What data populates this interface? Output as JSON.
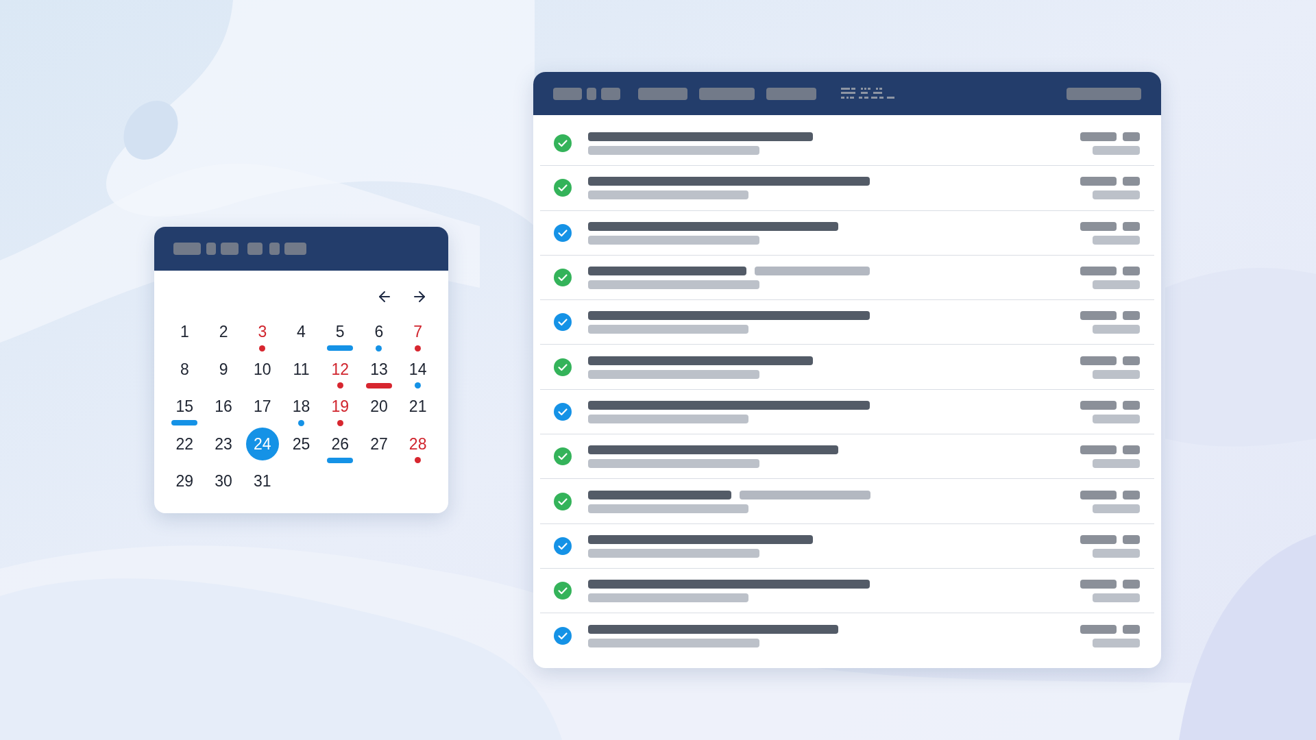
{
  "calendar": {
    "days": [
      {
        "label": "1",
        "selected": false,
        "flagged": false
      },
      {
        "label": "2",
        "selected": false,
        "flagged": false
      },
      {
        "label": "3",
        "selected": false,
        "flagged": true,
        "marker": {
          "kind": "dot",
          "color": "#d7262f"
        }
      },
      {
        "label": "4",
        "selected": false,
        "flagged": false
      },
      {
        "label": "5",
        "selected": false,
        "flagged": false,
        "marker": {
          "kind": "bar",
          "color": "#1592e6"
        }
      },
      {
        "label": "6",
        "selected": false,
        "flagged": false,
        "marker": {
          "kind": "dot",
          "color": "#1592e6"
        }
      },
      {
        "label": "7",
        "selected": false,
        "flagged": true,
        "marker": {
          "kind": "dot",
          "color": "#d7262f"
        }
      },
      {
        "label": "8",
        "selected": false,
        "flagged": false
      },
      {
        "label": "9",
        "selected": false,
        "flagged": false
      },
      {
        "label": "10",
        "selected": false,
        "flagged": false
      },
      {
        "label": "11",
        "selected": false,
        "flagged": false
      },
      {
        "label": "12",
        "selected": false,
        "flagged": true,
        "marker": {
          "kind": "dot",
          "color": "#d7262f"
        }
      },
      {
        "label": "13",
        "selected": false,
        "flagged": false,
        "marker": {
          "kind": "bar",
          "color": "#d7262f"
        }
      },
      {
        "label": "14",
        "selected": false,
        "flagged": false,
        "marker": {
          "kind": "dot",
          "color": "#1592e6"
        }
      },
      {
        "label": "15",
        "selected": false,
        "flagged": false,
        "marker": {
          "kind": "bar",
          "color": "#1592e6"
        }
      },
      {
        "label": "16",
        "selected": false,
        "flagged": false
      },
      {
        "label": "17",
        "selected": false,
        "flagged": false
      },
      {
        "label": "18",
        "selected": false,
        "flagged": false,
        "marker": {
          "kind": "dot",
          "color": "#1592e6"
        }
      },
      {
        "label": "19",
        "selected": false,
        "flagged": true,
        "marker": {
          "kind": "dot",
          "color": "#d7262f"
        }
      },
      {
        "label": "20",
        "selected": false,
        "flagged": false
      },
      {
        "label": "21",
        "selected": false,
        "flagged": false
      },
      {
        "label": "22",
        "selected": false,
        "flagged": false
      },
      {
        "label": "23",
        "selected": false,
        "flagged": false
      },
      {
        "label": "24",
        "selected": true,
        "flagged": false
      },
      {
        "label": "25",
        "selected": false,
        "flagged": false
      },
      {
        "label": "26",
        "selected": false,
        "flagged": false,
        "marker": {
          "kind": "bar",
          "color": "#1592e6"
        }
      },
      {
        "label": "27",
        "selected": false,
        "flagged": false
      },
      {
        "label": "28",
        "selected": false,
        "flagged": true,
        "marker": {
          "kind": "dot",
          "color": "#d7262f"
        }
      },
      {
        "label": "29",
        "selected": false,
        "flagged": false
      },
      {
        "label": "30",
        "selected": false,
        "flagged": false
      },
      {
        "label": "31",
        "selected": false,
        "flagged": false
      }
    ]
  },
  "task_list": {
    "rows": [
      {
        "color": "#34b35a",
        "kind": "single"
      },
      {
        "color": "#34b35a",
        "kind": "single"
      },
      {
        "color": "#1592e6",
        "kind": "single"
      },
      {
        "color": "#34b35a",
        "kind": "split"
      },
      {
        "color": "#1592e6",
        "kind": "single"
      },
      {
        "color": "#34b35a",
        "kind": "single"
      },
      {
        "color": "#1592e6",
        "kind": "single"
      },
      {
        "color": "#34b35a",
        "kind": "single"
      },
      {
        "color": "#34b35a",
        "kind": "split"
      },
      {
        "color": "#1592e6",
        "kind": "single"
      },
      {
        "color": "#34b35a",
        "kind": "single"
      },
      {
        "color": "#1592e6",
        "kind": "single"
      }
    ]
  }
}
